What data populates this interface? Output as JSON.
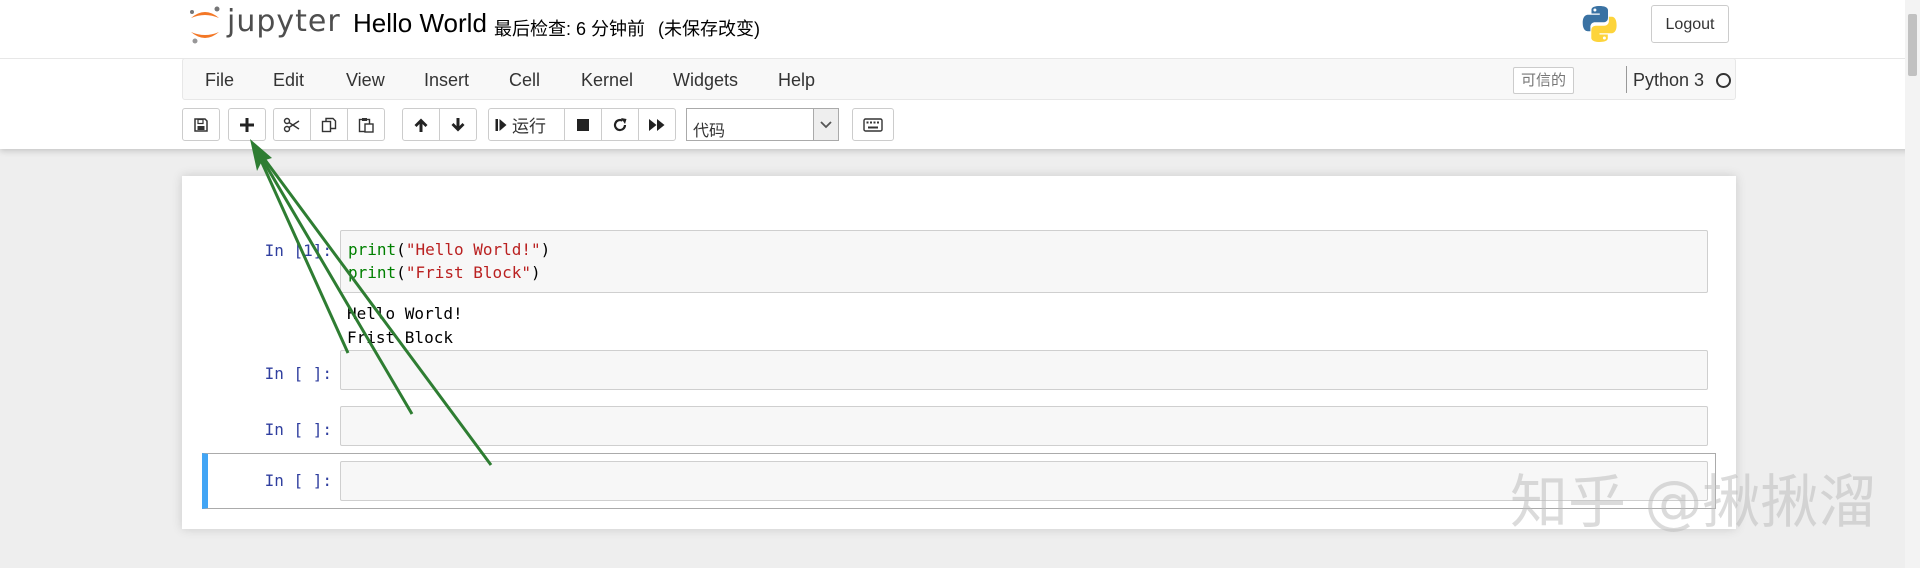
{
  "header": {
    "logo_text": "jupyter",
    "notebook_title": "Hello World",
    "checkpoint_text": "最后检查: 6 分钟前",
    "save_status": "(未保存改变)",
    "logout_label": "Logout"
  },
  "menubar": {
    "items": [
      {
        "label": "File"
      },
      {
        "label": "Edit"
      },
      {
        "label": "View"
      },
      {
        "label": "Insert"
      },
      {
        "label": "Cell"
      },
      {
        "label": "Kernel"
      },
      {
        "label": "Widgets"
      },
      {
        "label": "Help"
      }
    ],
    "trusted_label": "可信的",
    "kernel_name": "Python 3"
  },
  "toolbar": {
    "run_label": "运行",
    "cell_type": "代码",
    "icons": [
      "save-icon",
      "plus-icon",
      "scissors-icon",
      "copy-icon",
      "paste-icon",
      "arrow-up-icon",
      "arrow-down-icon",
      "step-forward-icon",
      "stop-icon",
      "restart-icon",
      "fast-forward-icon",
      "keyboard-icon"
    ]
  },
  "cells": [
    {
      "prompt": "In [1]:",
      "code": [
        "print(\"Hello World!\")",
        "print(\"Frist Block\")"
      ],
      "output": [
        "Hello World!",
        "Frist Block"
      ]
    },
    {
      "prompt": "In [ ]:",
      "code": [],
      "output": []
    },
    {
      "prompt": "In [ ]:",
      "code": [],
      "output": []
    },
    {
      "prompt": "In [ ]:",
      "code": [],
      "output": [],
      "selected": true
    }
  ],
  "watermark": "知乎 @揪揪溜",
  "colors": {
    "arrow": "#2e7d32",
    "selected_cell_bar": "#42a5f5",
    "prompt": "#303f9f",
    "keyword": "#008000",
    "string": "#ba2121"
  }
}
